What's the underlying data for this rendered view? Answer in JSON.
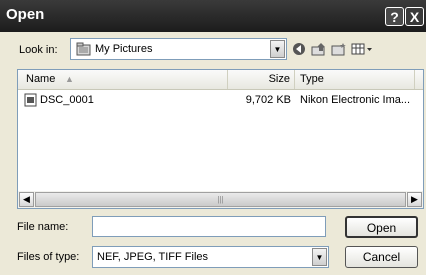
{
  "window": {
    "title": "Open"
  },
  "titlebar_buttons": {
    "help": "?",
    "close": "X"
  },
  "lookin": {
    "label": "Look in:",
    "value": "My Pictures"
  },
  "toolbar_icons": [
    "back-icon",
    "up-folder-icon",
    "new-folder-icon",
    "views-menu-icon"
  ],
  "columns": {
    "name": "Name",
    "size": "Size",
    "type": "Type"
  },
  "files": [
    {
      "name": "DSC_0001",
      "size": "9,702 KB",
      "type": "Nikon Electronic Ima..."
    }
  ],
  "filename": {
    "label": "File name:",
    "value": ""
  },
  "filetype": {
    "label": "Files of type:",
    "value": "NEF, JPEG, TIFF Files"
  },
  "buttons": {
    "open": "Open",
    "cancel": "Cancel"
  }
}
